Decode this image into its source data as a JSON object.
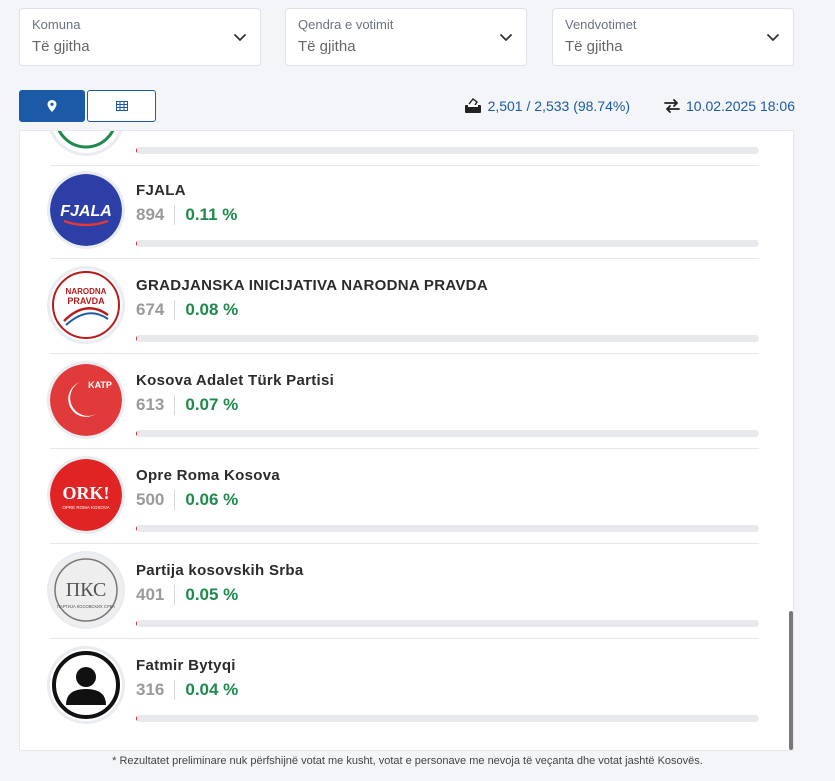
{
  "filters": [
    {
      "label": "Komuna",
      "value": "Të gjitha"
    },
    {
      "label": "Qendra e votimit",
      "value": "Të gjitha"
    },
    {
      "label": "Vendvotimet",
      "value": "Të gjitha"
    }
  ],
  "view_toggle": {
    "map_icon": "map-pin-icon",
    "table_icon": "table-icon",
    "active": "map"
  },
  "stats": {
    "ballot_icon": "ballot-box-icon",
    "counted": "2,501 / 2,533 (98.74%)",
    "refresh_icon": "swap-arrows-icon",
    "updated": "10.02.2025 18:06"
  },
  "results": [
    {
      "name": "FJALA",
      "votes": "894",
      "percent": "0.11 %",
      "share": 0.11,
      "logo": "fjala-logo",
      "logo_bg": "#2b3fa6"
    },
    {
      "name": "GRADJANSKA INICIJATIVA NARODNA PRAVDA",
      "votes": "674",
      "percent": "0.08 %",
      "share": 0.08,
      "logo": "narodna-pravda-logo",
      "logo_bg": "#ffffff"
    },
    {
      "name": "Kosova Adalet Türk Partisi",
      "votes": "613",
      "percent": "0.07 %",
      "share": 0.07,
      "logo": "katp-logo",
      "logo_bg": "#e03a3a"
    },
    {
      "name": "Opre Roma Kosova",
      "votes": "500",
      "percent": "0.06 %",
      "share": 0.06,
      "logo": "ork-logo",
      "logo_bg": "#e02424"
    },
    {
      "name": "Partija kosovskih Srba",
      "votes": "401",
      "percent": "0.05 %",
      "share": 0.05,
      "logo": "pks-logo",
      "logo_bg": "#eeeeee"
    },
    {
      "name": "Fatmir Bytyqi",
      "votes": "316",
      "percent": "0.04 %",
      "share": 0.04,
      "logo": "person-avatar-icon",
      "logo_bg": "#ffffff"
    }
  ],
  "logos_text": {
    "fjala": "FJALA",
    "narodna_pravda": [
      "NARODNA",
      "PRAVDA"
    ],
    "katp": "KATP",
    "ork": "ORK!",
    "ork_sub": "OPRE ROMA KOSOVA",
    "pks": "ПКС",
    "pks_sub": "ПАРТИЈА КОСОВСКИХ СРБА"
  },
  "accent_color": "#1b5aa6",
  "percent_color": "#1e8a4c",
  "footnote": "* Rezultatet preliminare nuk përfshijnë votat me kusht, votat e personave me nevoja të veçanta dhe votat jashtë Kosovës."
}
